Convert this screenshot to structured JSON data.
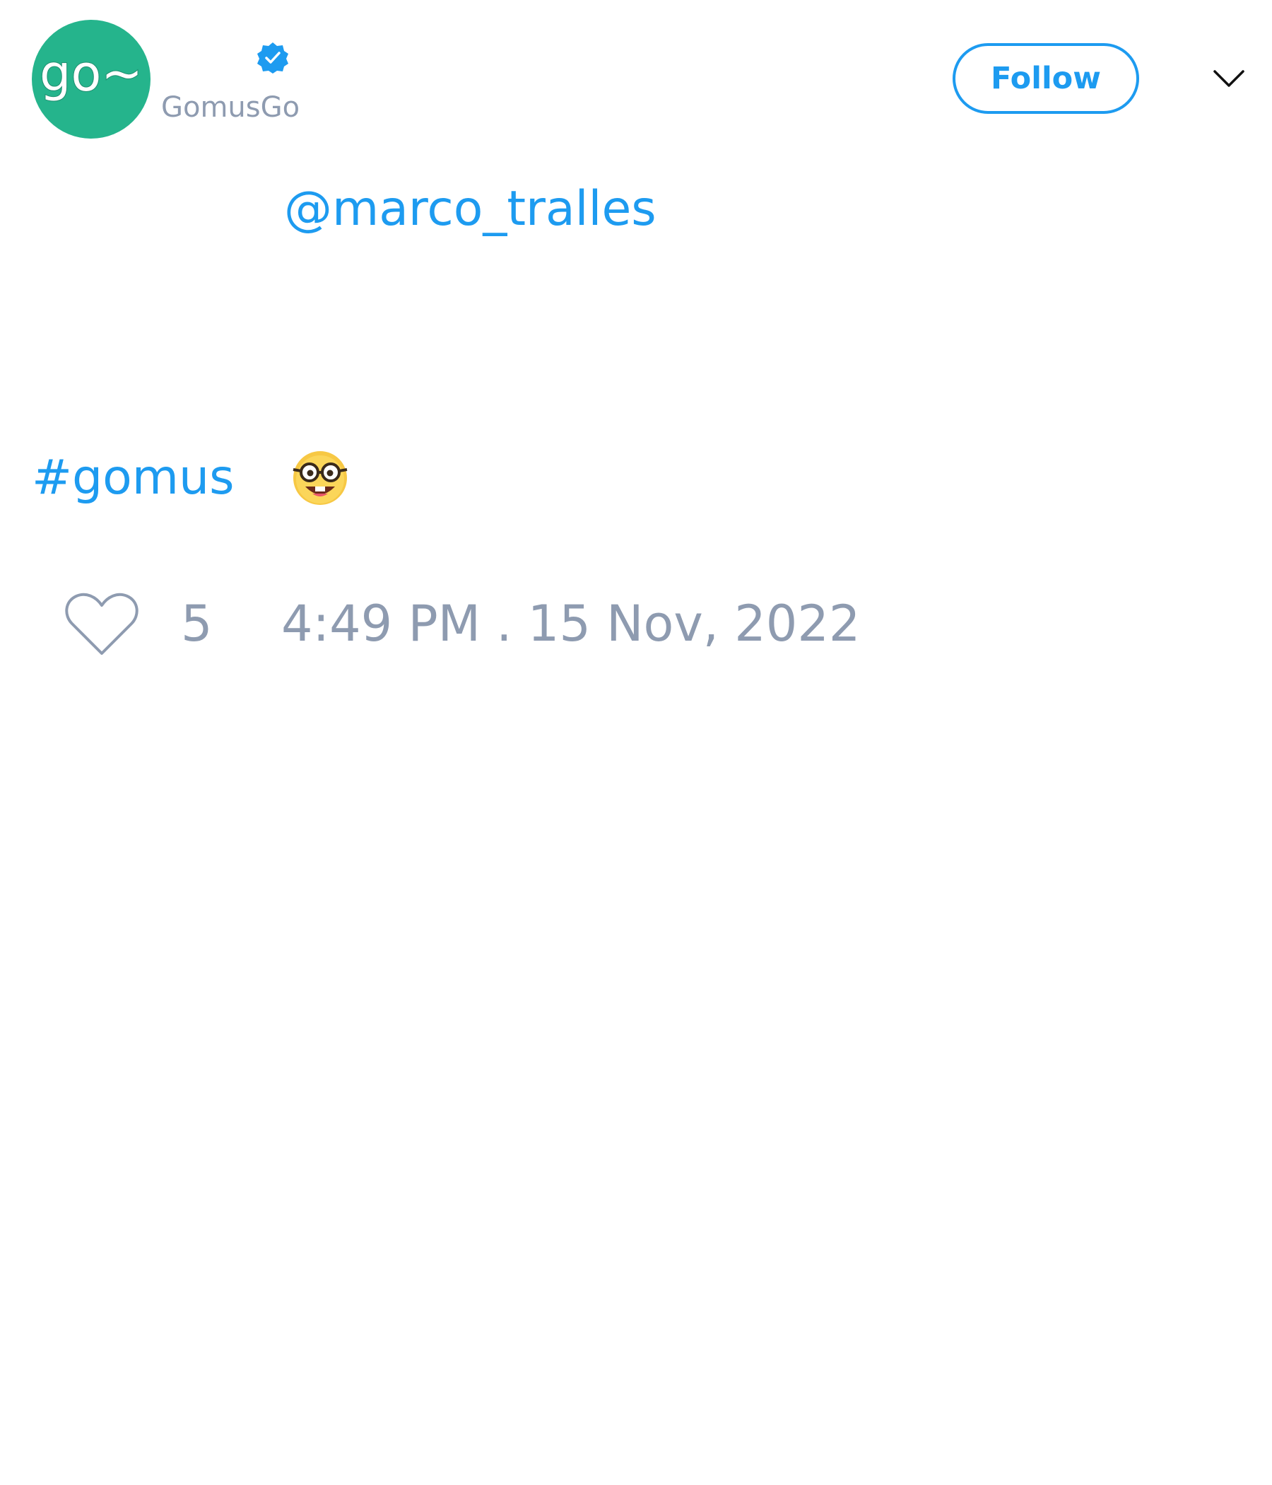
{
  "author": {
    "avatar_text": "go~",
    "handle": "GomusGo",
    "verified_icon": "verified-badge-icon"
  },
  "header": {
    "follow_label": "Follow",
    "menu_icon": "chevron-down-icon"
  },
  "tweet": {
    "mention": "@marco_tralles",
    "hashtag": "#gomus",
    "emoji": "🤓"
  },
  "footer": {
    "like_icon": "heart-icon",
    "like_count": "5",
    "timestamp": "4:49 PM . 15 Nov, 2022"
  },
  "colors": {
    "accent": "#1d9bf0",
    "avatar_bg": "#25b48c",
    "muted_text": "#8e9bb0"
  }
}
